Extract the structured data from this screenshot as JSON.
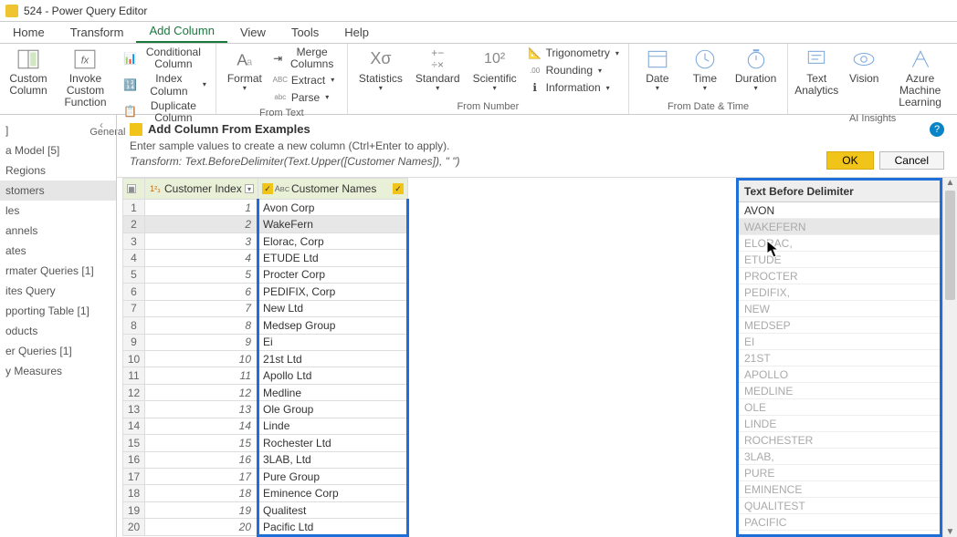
{
  "title": "524 - Power Query Editor",
  "menu": [
    "Home",
    "Transform",
    "Add Column",
    "View",
    "Tools",
    "Help"
  ],
  "menu_active": 2,
  "ribbon": {
    "general": {
      "label": "General",
      "custom_column": "Custom\nColumn",
      "invoke": "Invoke Custom\nFunction",
      "conditional": "Conditional Column",
      "index": "Index Column",
      "duplicate": "Duplicate Column"
    },
    "fromtext": {
      "label": "From Text",
      "format": "Format",
      "merge": "Merge Columns",
      "extract": "Extract",
      "parse": "Parse"
    },
    "fromnumber": {
      "label": "From Number",
      "statistics": "Statistics",
      "standard": "Standard",
      "scientific": "Scientific",
      "trig": "Trigonometry",
      "round": "Rounding",
      "info": "Information"
    },
    "fromdatetime": {
      "label": "From Date & Time",
      "date": "Date",
      "time": "Time",
      "duration": "Duration"
    },
    "ai": {
      "label": "AI Insights",
      "text": "Text\nAnalytics",
      "vision": "Vision",
      "azure": "Azure Machine\nLearning"
    }
  },
  "queries": [
    "]",
    "a Model [5]",
    "Regions",
    "stomers",
    "les",
    "annels",
    "ates",
    "rmater Queries [1]",
    "ites Query",
    "pporting Table [1]",
    "oducts",
    "er Queries [1]",
    "y Measures"
  ],
  "query_active": 3,
  "example": {
    "title": "Add Column From Examples",
    "sub": "Enter sample values to create a new column (Ctrl+Enter to apply).",
    "formula": "Transform: Text.BeforeDelimiter(Text.Upper([Customer Names]), \" \")",
    "ok": "OK",
    "cancel": "Cancel"
  },
  "columns": {
    "index": "Customer Index",
    "names": "Customer Names",
    "preview": "Text Before Delimiter"
  },
  "rows": [
    {
      "n": 1,
      "name": "Avon Corp",
      "pv": "AVON",
      "solid": true
    },
    {
      "n": 2,
      "name": "WakeFern",
      "pv": "WAKEFERN",
      "solid": false,
      "sel": true
    },
    {
      "n": 3,
      "name": "Elorac, Corp",
      "pv": "ELORAC,",
      "solid": false
    },
    {
      "n": 4,
      "name": "ETUDE Ltd",
      "pv": "ETUDE",
      "solid": false
    },
    {
      "n": 5,
      "name": "Procter Corp",
      "pv": "PROCTER",
      "solid": false
    },
    {
      "n": 6,
      "name": "PEDIFIX, Corp",
      "pv": "PEDIFIX,",
      "solid": false
    },
    {
      "n": 7,
      "name": "New Ltd",
      "pv": "NEW",
      "solid": false
    },
    {
      "n": 8,
      "name": "Medsep Group",
      "pv": "MEDSEP",
      "solid": false
    },
    {
      "n": 9,
      "name": "Ei",
      "pv": "EI",
      "solid": false
    },
    {
      "n": 10,
      "name": "21st Ltd",
      "pv": "21ST",
      "solid": false
    },
    {
      "n": 11,
      "name": "Apollo Ltd",
      "pv": "APOLLO",
      "solid": false
    },
    {
      "n": 12,
      "name": "Medline",
      "pv": "MEDLINE",
      "solid": false
    },
    {
      "n": 13,
      "name": "Ole Group",
      "pv": "OLE",
      "solid": false
    },
    {
      "n": 14,
      "name": "Linde",
      "pv": "LINDE",
      "solid": false
    },
    {
      "n": 15,
      "name": "Rochester Ltd",
      "pv": "ROCHESTER",
      "solid": false
    },
    {
      "n": 16,
      "name": "3LAB, Ltd",
      "pv": "3LAB,",
      "solid": false
    },
    {
      "n": 17,
      "name": "Pure Group",
      "pv": "PURE",
      "solid": false
    },
    {
      "n": 18,
      "name": "Eminence Corp",
      "pv": "EMINENCE",
      "solid": false
    },
    {
      "n": 19,
      "name": "Qualitest",
      "pv": "QUALITEST",
      "solid": false
    },
    {
      "n": 20,
      "name": "Pacific Ltd",
      "pv": "PACIFIC",
      "solid": false
    }
  ]
}
